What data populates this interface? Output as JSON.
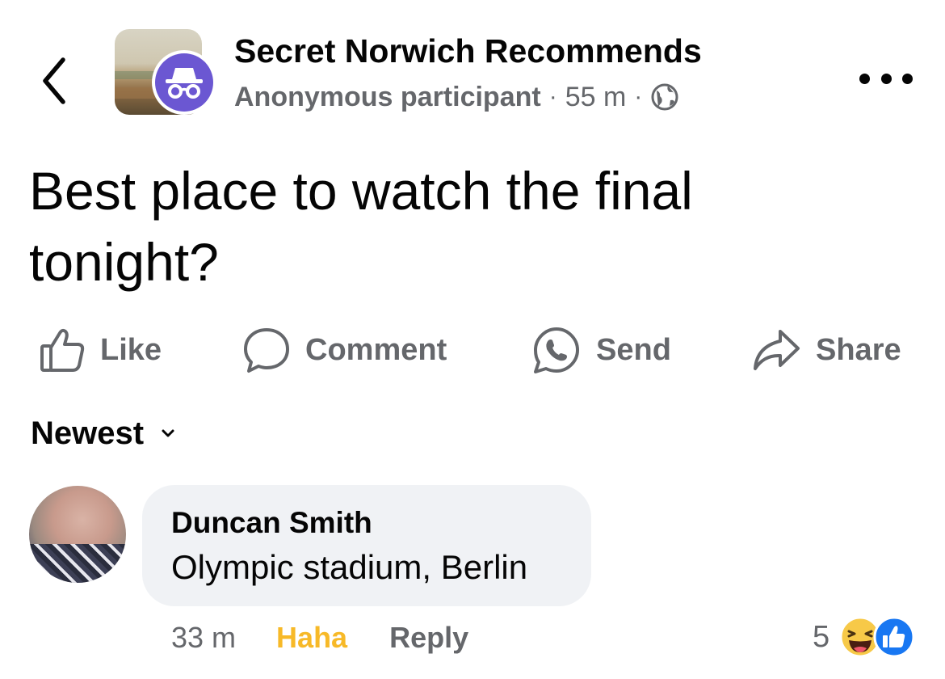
{
  "header": {
    "group_name": "Secret Norwich Recommends",
    "author": "Anonymous participant",
    "separator": "·",
    "time": "55 m",
    "audience_icon": "globe-icon",
    "back_icon": "chevron-left-icon",
    "more_icon": "more-dots-icon",
    "badge_icon": "incognito-icon",
    "badge_color": "#6b57d2"
  },
  "post": {
    "line1": "Best place to watch the final",
    "line2": "tonight?"
  },
  "actions": {
    "like": "Like",
    "comment": "Comment",
    "send": "Send",
    "share": "Share",
    "icon_color": "#65676b"
  },
  "sort": {
    "label": "Newest",
    "icon": "chevron-down-icon"
  },
  "comment": {
    "author": "Duncan Smith",
    "text": "Olympic stadium, Berlin",
    "time": "33 m",
    "reaction_label": "Haha",
    "reaction_color": "#f7b928",
    "reply_label": "Reply",
    "reaction_count": "5",
    "reaction_icons": [
      "haha-emoji-icon",
      "like-emoji-icon"
    ],
    "bubble_color": "#f0f2f5"
  }
}
